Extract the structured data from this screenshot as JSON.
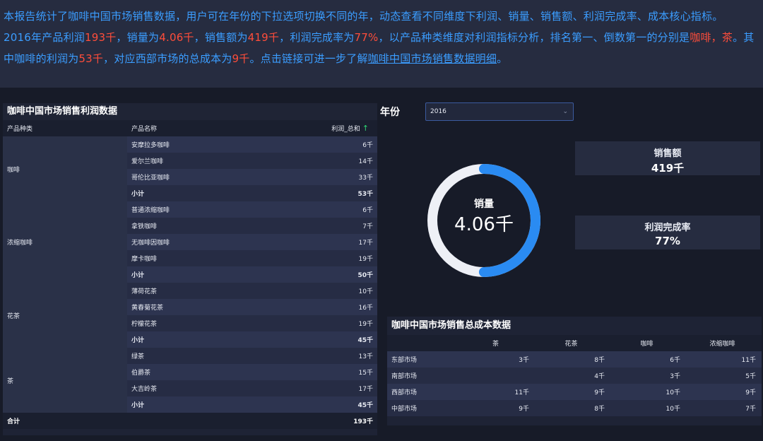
{
  "intro": {
    "line1": "本报告统计了咖啡中国市场销售数据，用户可在年份的下拉选项切换不同的年，动态查看不同维度下利润、销量、销售额、利润完成率、成本核心指标。",
    "p2a": "2016年产品利润",
    "profit": "193千",
    "p2b": "，销量为",
    "sales_qty": "4.06千",
    "p2c": "，销售额为",
    "revenue": "419千",
    "p2d": "，利润完成率为",
    "rate": "77%",
    "p2e": "，以产品种类维度对利润指标分析，排名第一、倒数第一的分别是",
    "top_bottom": "咖啡，茶",
    "p2f": "。其中咖啡的利润为",
    "coffee_profit": "53千",
    "p2g": "，对应西部市场的总成本为",
    "west_cost": "9千",
    "p2h": "。点击链接可进一步了解",
    "link": "咖啡中国市场销售数据明细",
    "end": "。"
  },
  "profit_table": {
    "title": "咖啡中国市场销售利润数据",
    "headers": {
      "category": "产品种类",
      "product": "产品名称",
      "value": "利润_总和"
    },
    "groups": [
      {
        "name": "咖啡",
        "rows": [
          {
            "name": "安摩拉多咖啡",
            "value": "6千"
          },
          {
            "name": "爱尔兰咖啡",
            "value": "14千"
          },
          {
            "name": "哥伦比亚咖啡",
            "value": "33千"
          },
          {
            "name": "小计",
            "value": "53千",
            "subtotal": true
          }
        ]
      },
      {
        "name": "浓缩咖啡",
        "rows": [
          {
            "name": "普通浓缩咖啡",
            "value": "6千"
          },
          {
            "name": "拿铁咖啡",
            "value": "7千"
          },
          {
            "name": "无咖啡因咖啡",
            "value": "17千"
          },
          {
            "name": "摩卡咖啡",
            "value": "19千"
          },
          {
            "name": "小计",
            "value": "50千",
            "subtotal": true
          }
        ]
      },
      {
        "name": "花茶",
        "rows": [
          {
            "name": "薄荷花茶",
            "value": "10千"
          },
          {
            "name": "黄春菊花茶",
            "value": "16千"
          },
          {
            "name": "柠檬花茶",
            "value": "19千"
          },
          {
            "name": "小计",
            "value": "45千",
            "subtotal": true
          }
        ]
      },
      {
        "name": "茶",
        "rows": [
          {
            "name": "绿茶",
            "value": "13千"
          },
          {
            "name": "伯爵茶",
            "value": "15千"
          },
          {
            "name": "大吉岭茶",
            "value": "17千"
          },
          {
            "name": "小计",
            "value": "45千",
            "subtotal": true
          }
        ]
      }
    ],
    "total_label": "合计",
    "total_value": "193千"
  },
  "filter": {
    "label": "年份",
    "value": "2016"
  },
  "gauge": {
    "label": "销量",
    "value": "4.06千",
    "fraction": 0.5
  },
  "kpis": {
    "revenue": {
      "label": "销售额",
      "value": "419千"
    },
    "rate": {
      "label": "利润完成率",
      "value": "77%"
    }
  },
  "cost_table": {
    "title": "咖啡中国市场销售总成本数据",
    "columns": [
      "茶",
      "花茶",
      "咖啡",
      "浓缩咖啡"
    ],
    "rows": [
      {
        "market": "东部市场",
        "values": [
          "3千",
          "8千",
          "6千",
          "11千"
        ]
      },
      {
        "market": "南部市场",
        "values": [
          "",
          "4千",
          "3千",
          "5千"
        ]
      },
      {
        "market": "西部市场",
        "values": [
          "11千",
          "9千",
          "10千",
          "9千"
        ]
      },
      {
        "market": "中部市场",
        "values": [
          "9千",
          "8千",
          "10千",
          "7千"
        ]
      }
    ]
  },
  "colors": {
    "accent": "#3b9dff",
    "highlight": "#ff4d3a",
    "background": "#171b28",
    "panel": "#262c40"
  }
}
